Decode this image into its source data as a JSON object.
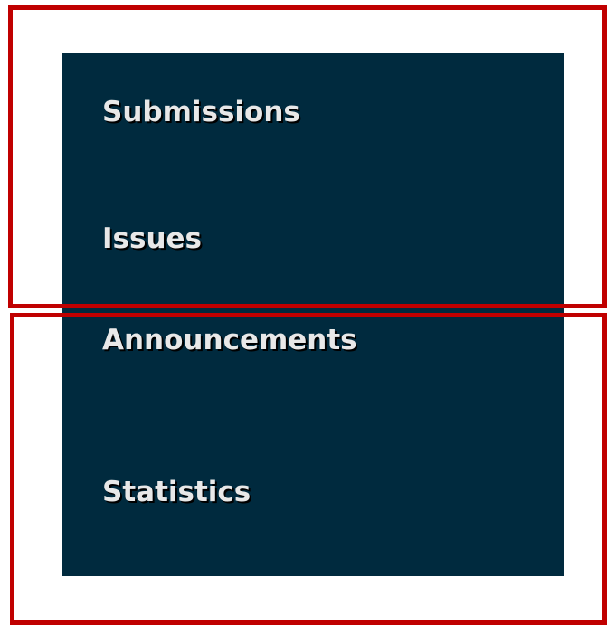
{
  "nav": {
    "items": [
      {
        "label": "Submissions"
      },
      {
        "label": "Issues"
      },
      {
        "label": "Announcements"
      },
      {
        "label": "Statistics"
      }
    ]
  },
  "colors": {
    "panel_background": "#002a3e",
    "item_text": "#e8e8e8",
    "highlight_border": "#c00000"
  }
}
